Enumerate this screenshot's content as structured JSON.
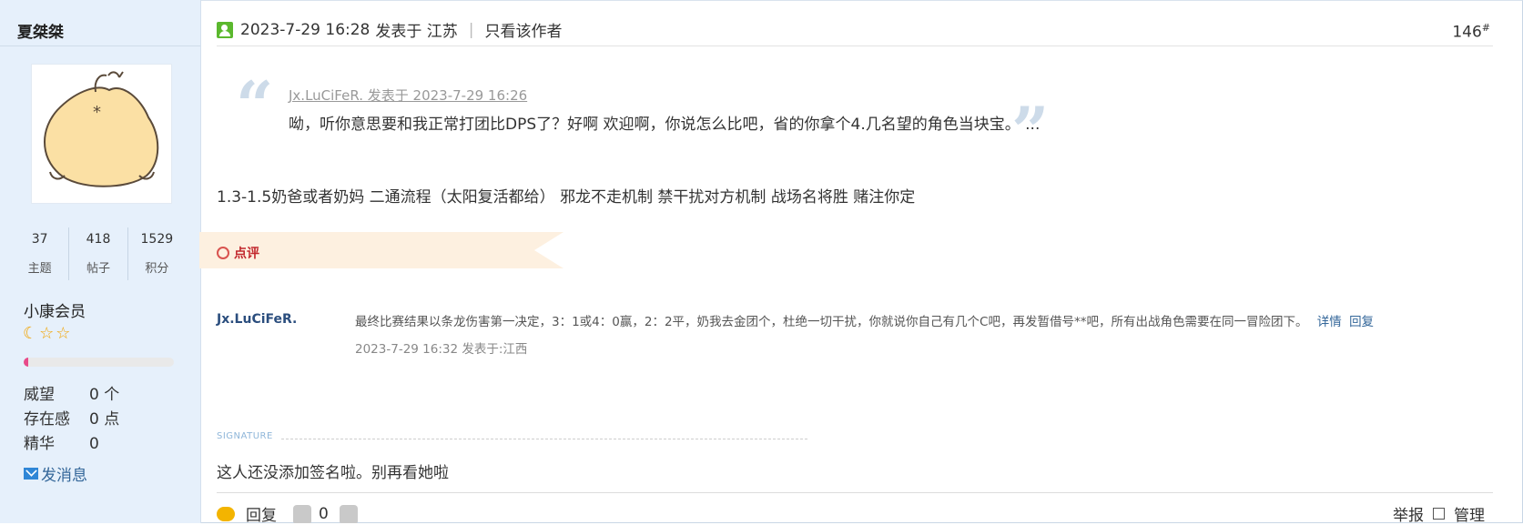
{
  "sidebar": {
    "author": "夏桀桀",
    "stats": [
      {
        "value": "37",
        "label": "主题"
      },
      {
        "value": "418",
        "label": "帖子"
      },
      {
        "value": "1529",
        "label": "积分"
      }
    ],
    "member_group": "小康会员",
    "stars": [
      "☾",
      "☆",
      "☆"
    ],
    "level_progress": 0.02,
    "props": [
      {
        "key": "威望",
        "value": "0 个"
      },
      {
        "key": "存在感",
        "value": "0 点"
      },
      {
        "key": "精华",
        "value": "0"
      }
    ],
    "send_message": "发消息"
  },
  "post": {
    "date": "2023-7-29 16:28",
    "posted_in": "发表于 江苏",
    "only_author": "只看该作者",
    "floor": "146",
    "floor_mark": "#",
    "quote": {
      "source": "Jx.LuCiFeR. 发表于 2023-7-29 16:26",
      "text": "呦，听你意思要和我正常打团比DPS了？好啊 欢迎啊，你说怎么比吧，省的你拿个4.几名望的角色当块宝。 ..."
    },
    "body": "1.3-1.5奶爸或者奶妈 二通流程（太阳复活都给） 邪龙不走机制 禁干扰对方机制 战场名将胜 赌注你定",
    "review_label": "点评",
    "review": {
      "user": "Jx.LuCiFeR.",
      "text": "最终比赛结果以条龙伤害第一决定，3：1或4：0赢，2：2平，奶我去金团个，杜绝一切干扰，你就说你自己有几个C吧，再发暂借号**吧，所有出战角色需要在同一冒险团下。",
      "detail_link": "详情",
      "reply_link": "回复",
      "time": "2023-7-29 16:32 发表于:江西"
    },
    "signature_label": "SIGNATURE",
    "signature": "这人还没添加签名啦。别再看她啦",
    "footer": {
      "reply": "回复",
      "like_count": "0",
      "report": "举报",
      "manage": "管理"
    }
  },
  "colors": {
    "sidebar_bg": "#e6f0fb",
    "review_tab_bg": "#fdf0e0",
    "review_label": "#c2272d",
    "link": "#336699",
    "online_icon": "#5bb82e"
  }
}
